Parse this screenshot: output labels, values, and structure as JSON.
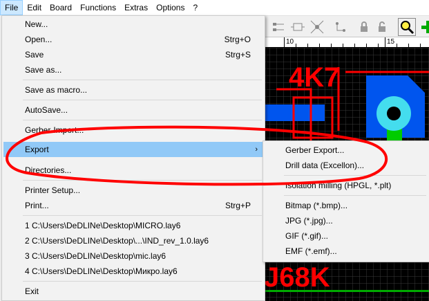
{
  "menubar": {
    "items": [
      "File",
      "Edit",
      "Board",
      "Functions",
      "Extras",
      "Options",
      "?"
    ]
  },
  "file_menu": {
    "items": [
      {
        "label": "New...",
        "shortcut": ""
      },
      {
        "label": "Open...",
        "shortcut": "Strg+O"
      },
      {
        "label": "Save",
        "shortcut": "Strg+S"
      },
      {
        "label": "Save as...",
        "shortcut": ""
      },
      {
        "label": "Save as macro...",
        "shortcut": ""
      },
      {
        "label": "AutoSave...",
        "shortcut": ""
      },
      {
        "label": "Gerber-Import...",
        "shortcut": ""
      },
      {
        "label": "Export",
        "shortcut": ""
      },
      {
        "label": "Directories...",
        "shortcut": ""
      },
      {
        "label": "Printer Setup...",
        "shortcut": ""
      },
      {
        "label": "Print...",
        "shortcut": "Strg+P"
      },
      {
        "label": "1 C:\\Users\\DeDLINe\\Desktop\\MICRO.lay6",
        "shortcut": ""
      },
      {
        "label": "2 C:\\Users\\DeDLINe\\Desktop\\...\\IND_rev_1.0.lay6",
        "shortcut": ""
      },
      {
        "label": "3 C:\\Users\\DeDLINe\\Desktop\\mic.lay6",
        "shortcut": ""
      },
      {
        "label": "4 C:\\Users\\DeDLINe\\Desktop\\Микро.lay6",
        "shortcut": ""
      },
      {
        "label": "Exit",
        "shortcut": ""
      }
    ],
    "submenu_arrow": "›"
  },
  "export_submenu": {
    "items": [
      "Gerber Export...",
      "Drill data (Excellon)...",
      "Isolation milling (HPGL, *.plt)",
      "Bitmap (*.bmp)...",
      "JPG (*.jpg)...",
      "GIF (*.gif)...",
      "EMF (*.emf)..."
    ]
  },
  "ruler": {
    "labels": [
      "10",
      "15"
    ]
  },
  "pcb": {
    "labels": [
      "4K7",
      "J68K"
    ],
    "colors": {
      "silk": "#ff0000",
      "copper": "#0055ee",
      "pad": "#00cc00",
      "hole": "#44ddee",
      "grid": "#333333"
    }
  },
  "annotation": {
    "color": "#ff0000"
  }
}
